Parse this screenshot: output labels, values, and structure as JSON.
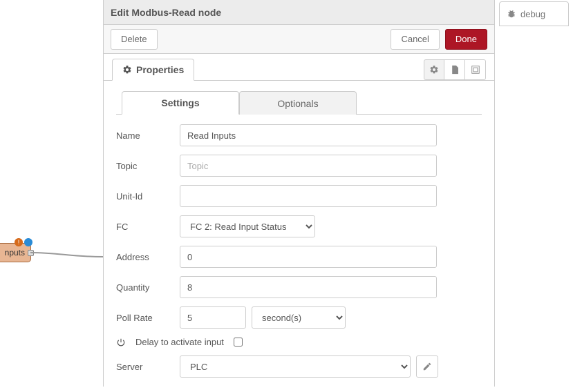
{
  "canvas": {
    "node_label": "nputs"
  },
  "editor": {
    "title": "Edit Modbus-Read node",
    "actions": {
      "delete_label": "Delete",
      "cancel_label": "Cancel",
      "done_label": "Done"
    },
    "tabs": {
      "properties_label": "Properties"
    },
    "inner_tabs": {
      "settings_label": "Settings",
      "optionals_label": "Optionals"
    },
    "form": {
      "name": {
        "label": "Name",
        "value": "Read Inputs"
      },
      "topic": {
        "label": "Topic",
        "placeholder": "Topic",
        "value": ""
      },
      "unitid": {
        "label": "Unit-Id",
        "value": ""
      },
      "fc": {
        "label": "FC",
        "value": "FC 2: Read Input Status"
      },
      "address": {
        "label": "Address",
        "value": "0"
      },
      "quantity": {
        "label": "Quantity",
        "value": "8"
      },
      "pollrate": {
        "label": "Poll Rate",
        "value": "5",
        "unit": "second(s)"
      },
      "delay": {
        "label": "Delay to activate input",
        "checked": false
      },
      "server": {
        "label": "Server",
        "value": "PLC"
      }
    }
  },
  "sidebar": {
    "debug_label": "debug"
  }
}
